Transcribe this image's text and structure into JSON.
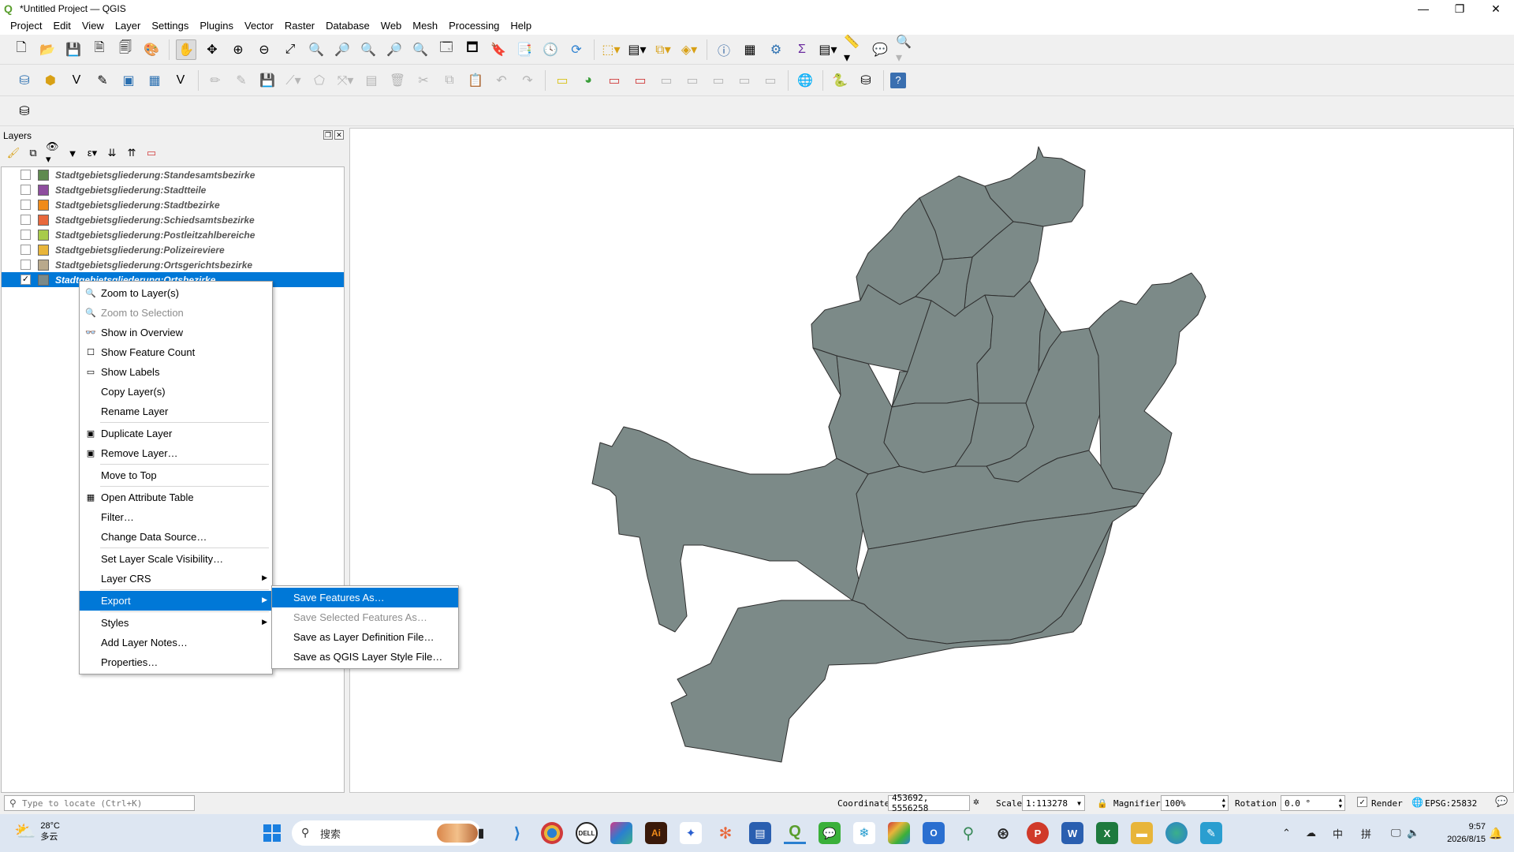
{
  "window": {
    "title": "*Untitled Project — QGIS",
    "controls": [
      "—",
      "❐",
      "✕"
    ]
  },
  "menubar": [
    "Project",
    "Edit",
    "View",
    "Layer",
    "Settings",
    "Plugins",
    "Vector",
    "Raster",
    "Database",
    "Web",
    "Mesh",
    "Processing",
    "Help"
  ],
  "layers_panel": {
    "title": "Layers",
    "layers": [
      {
        "name": "Stadtgebietsgliederung:Standesamtsbezirke",
        "color": "#5f8a4f",
        "checked": false
      },
      {
        "name": "Stadtgebietsgliederung:Stadtteile",
        "color": "#8e4d9e",
        "checked": false
      },
      {
        "name": "Stadtgebietsgliederung:Stadtbezirke",
        "color": "#f08b1a",
        "checked": false
      },
      {
        "name": "Stadtgebietsgliederung:Schiedsamtsbezirke",
        "color": "#e8683c",
        "checked": false
      },
      {
        "name": "Stadtgebietsgliederung:Postleitzahlbereiche",
        "color": "#a8cb4a",
        "checked": false
      },
      {
        "name": "Stadtgebietsgliederung:Polizeireviere",
        "color": "#e8b53a",
        "checked": false
      },
      {
        "name": "Stadtgebietsgliederung:Ortsgerichtsbezirke",
        "color": "#b9a98c",
        "checked": false
      },
      {
        "name": "Stadtgebietsgliederung:Ortsbezirke",
        "color": "#7c8a88",
        "checked": true
      }
    ]
  },
  "context_menu": {
    "items": [
      {
        "label": "Zoom to Layer(s)",
        "icon": "zoom-icon",
        "glyph": "🔍",
        "disabled": false
      },
      {
        "label": "Zoom to Selection",
        "icon": "zoom-selection-icon",
        "glyph": "🔍",
        "disabled": true
      },
      {
        "label": "Show in Overview",
        "icon": "overview-icon",
        "glyph": "👓",
        "disabled": false
      },
      {
        "label": "Show Feature Count",
        "icon": "checkbox-icon",
        "glyph": "☐",
        "disabled": false
      },
      {
        "label": "Show Labels",
        "icon": "labels-icon",
        "glyph": "▭",
        "disabled": false
      },
      {
        "label": "Copy Layer(s)",
        "icon": "",
        "glyph": "",
        "disabled": false
      },
      {
        "label": "Rename Layer",
        "icon": "",
        "glyph": "",
        "disabled": false,
        "sep_after": true
      },
      {
        "label": "Duplicate Layer",
        "icon": "duplicate-icon",
        "glyph": "▣",
        "disabled": false
      },
      {
        "label": "Remove Layer…",
        "icon": "remove-icon",
        "glyph": "▣",
        "disabled": false,
        "sep_after": true
      },
      {
        "label": "Move to Top",
        "icon": "",
        "glyph": "",
        "disabled": false,
        "sep_after": true
      },
      {
        "label": "Open Attribute Table",
        "icon": "table-icon",
        "glyph": "▦",
        "disabled": false
      },
      {
        "label": "Filter…",
        "icon": "",
        "glyph": "",
        "disabled": false
      },
      {
        "label": "Change Data Source…",
        "icon": "",
        "glyph": "",
        "disabled": false,
        "sep_after": true
      },
      {
        "label": "Set Layer Scale Visibility…",
        "icon": "",
        "glyph": "",
        "disabled": false
      },
      {
        "label": "Layer CRS",
        "icon": "",
        "glyph": "",
        "disabled": false,
        "submenu": true,
        "sep_after": true
      },
      {
        "label": "Export",
        "icon": "",
        "glyph": "",
        "disabled": false,
        "submenu": true,
        "active": true,
        "sep_after": true
      },
      {
        "label": "Styles",
        "icon": "",
        "glyph": "",
        "disabled": false,
        "submenu": true
      },
      {
        "label": "Add Layer Notes…",
        "icon": "",
        "glyph": "",
        "disabled": false
      },
      {
        "label": "Properties…",
        "icon": "",
        "glyph": "",
        "disabled": false
      }
    ]
  },
  "export_submenu": [
    {
      "label": "Save Features As…",
      "active": true,
      "disabled": false
    },
    {
      "label": "Save Selected Features As…",
      "active": false,
      "disabled": true
    },
    {
      "label": "Save as Layer Definition File…",
      "active": false,
      "disabled": false
    },
    {
      "label": "Save as QGIS Layer Style File…",
      "active": false,
      "disabled": false
    }
  ],
  "map": {
    "fill_color": "#7c8a88",
    "stroke_color": "#2e2e2e"
  },
  "statusbar": {
    "locator_placeholder": "Type to locate (Ctrl+K)",
    "coordinate_label": "Coordinate",
    "coordinate_value": "453692, 5556258",
    "scale_label": "Scale",
    "scale_value": "1:113278",
    "magnifier_label": "Magnifier",
    "magnifier_value": "100%",
    "rotation_label": "Rotation",
    "rotation_value": "0.0 °",
    "render_label": "Render",
    "crs_value": "EPSG:25832"
  },
  "taskbar": {
    "temperature": "28°C",
    "weather_text": "多云",
    "search_placeholder": "搜索",
    "time": "9:57",
    "date": "2026/8/15",
    "tray_ime_1": "中",
    "tray_ime_2": "拼"
  }
}
